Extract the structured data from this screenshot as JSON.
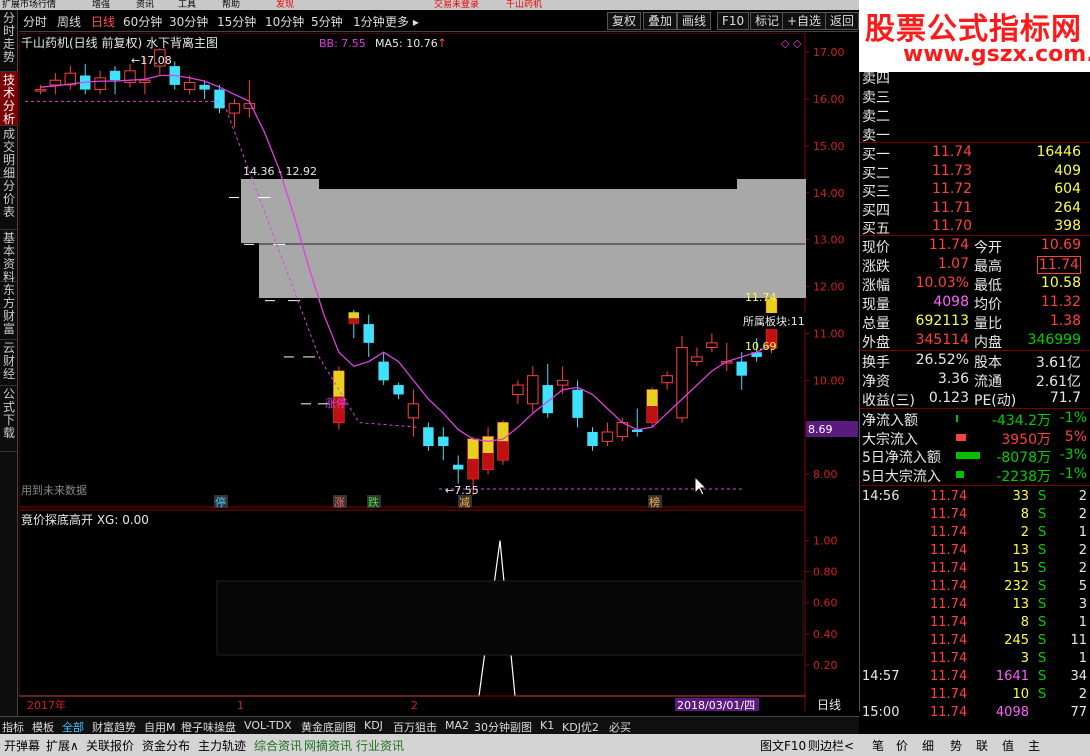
{
  "top_menu": [
    "扩展市场行情",
    "增强",
    "资讯",
    "工具",
    "帮助",
    "发现",
    "交易未登录",
    "千山药机"
  ],
  "sidebar": [
    "分时走势",
    "技术分析",
    "成交明细",
    "分价表",
    "基本资料",
    "东方财富",
    "云财经",
    "公式下载"
  ],
  "periods": [
    "分时",
    "周线",
    "日线",
    "60分钟",
    "30分钟",
    "15分钟",
    "10分钟",
    "5分钟",
    "1分钟",
    "更多 ▸"
  ],
  "tool_buttons": [
    "复权",
    "叠加",
    "画线",
    "F10",
    "标记",
    "+自选",
    "返回"
  ],
  "main": {
    "title": "千山药机(日线 前复权) 水下背离主图",
    "bb": "BB: 7.55",
    "ma5": "MA5: 10.76",
    "ma5_arrow": "↑",
    "y_ticks": [
      "17.00",
      "16.00",
      "15.00",
      "14.00",
      "13.00",
      "12.00",
      "11.00",
      "10.00",
      "9.00",
      "8.00"
    ],
    "high_label": "17.08",
    "low_label": "7.55",
    "range_label": "14.36 - 12.92",
    "last_label": "11.74",
    "prev_label": "10.69",
    "sector_label": "所属板块:11",
    "zt_label": "涨停",
    "future_label": "用到未来数据",
    "price_tag": "8.69",
    "markers": [
      "停",
      "涨",
      "跌",
      "减",
      "榜"
    ],
    "diamonds": "◇ ◇"
  },
  "indicator": {
    "title": "竟价探底高开 XG: 0.00",
    "y_ticks": [
      "1.00",
      "0.80",
      "0.60",
      "0.40",
      "0.20"
    ]
  },
  "x_axis": {
    "start": "2017年",
    "m1": "1",
    "m2": "2",
    "date": "2018/03/01/四",
    "mode": "日线"
  },
  "watermark": {
    "line1": "股票公式指标网",
    "line2": "www.gszx.com.cn"
  },
  "order_book": {
    "sell": [
      "卖四",
      "卖三",
      "卖二",
      "卖一"
    ],
    "buy": [
      {
        "l": "买一",
        "p": "11.74",
        "v": "16446"
      },
      {
        "l": "买二",
        "p": "11.73",
        "v": "409"
      },
      {
        "l": "买三",
        "p": "11.72",
        "v": "604"
      },
      {
        "l": "买四",
        "p": "11.71",
        "v": "264"
      },
      {
        "l": "买五",
        "p": "11.70",
        "v": "398"
      }
    ]
  },
  "quote": [
    {
      "l1": "现价",
      "v1": "11.74",
      "c1": "r",
      "l2": "今开",
      "v2": "10.69",
      "c2": "r"
    },
    {
      "l1": "涨跌",
      "v1": "1.07",
      "c1": "r",
      "l2": "最高",
      "v2": "11.74",
      "c2": "rb"
    },
    {
      "l1": "涨幅",
      "v1": "10.03%",
      "c1": "r",
      "l2": "最低",
      "v2": "10.58",
      "c2": "y"
    },
    {
      "l1": "现量",
      "v1": "4098",
      "c1": "m",
      "l2": "均价",
      "v2": "11.32",
      "c2": "r"
    },
    {
      "l1": "总量",
      "v1": "692113",
      "c1": "y",
      "l2": "量比",
      "v2": "1.38",
      "c2": "r"
    },
    {
      "l1": "外盘",
      "v1": "345114",
      "c1": "r",
      "l2": "内盘",
      "v2": "346999",
      "c2": "g"
    }
  ],
  "quote2": [
    {
      "l1": "换手",
      "v1": "26.52%",
      "l2": "股本",
      "v2": "3.61亿"
    },
    {
      "l1": "净资",
      "v1": "3.36",
      "l2": "流通",
      "v2": "2.61亿"
    },
    {
      "l1": "收益(三)",
      "v1": "0.123",
      "l2": "PE(动)",
      "v2": "71.7"
    }
  ],
  "flows": [
    {
      "l": "净流入额",
      "v": "-434.2万",
      "p": "-1%",
      "vc": "g",
      "bar": 0,
      "bc": "#00c000"
    },
    {
      "l": "大宗流入",
      "v": "3950万",
      "p": "5%",
      "vc": "r",
      "bar": 10,
      "bc": "#ff4040"
    },
    {
      "l": "5日净流入额",
      "v": "-8078万",
      "p": "-3%",
      "vc": "g",
      "bar": 24,
      "bc": "#00c000"
    },
    {
      "l": "5日大宗流入",
      "v": "-2238万",
      "p": "-1%",
      "vc": "g",
      "bar": 8,
      "bc": "#00c000"
    }
  ],
  "ticks": [
    {
      "t": "14:56",
      "p": "11.74",
      "v": "33",
      "s": "S",
      "n": "2"
    },
    {
      "t": "",
      "p": "11.74",
      "v": "8",
      "s": "S",
      "n": "2"
    },
    {
      "t": "",
      "p": "11.74",
      "v": "2",
      "s": "S",
      "n": "1"
    },
    {
      "t": "",
      "p": "11.74",
      "v": "13",
      "s": "S",
      "n": "2"
    },
    {
      "t": "",
      "p": "11.74",
      "v": "15",
      "s": "S",
      "n": "2"
    },
    {
      "t": "",
      "p": "11.74",
      "v": "232",
      "s": "S",
      "n": "5"
    },
    {
      "t": "",
      "p": "11.74",
      "v": "13",
      "s": "S",
      "n": "3"
    },
    {
      "t": "",
      "p": "11.74",
      "v": "8",
      "s": "S",
      "n": "1"
    },
    {
      "t": "",
      "p": "11.74",
      "v": "245",
      "s": "S",
      "n": "11"
    },
    {
      "t": "",
      "p": "11.74",
      "v": "3",
      "s": "S",
      "n": "1"
    },
    {
      "t": "14:57",
      "p": "11.74",
      "v": "1641",
      "s": "S",
      "n": "34"
    },
    {
      "t": "",
      "p": "11.74",
      "v": "10",
      "s": "S",
      "n": "2"
    },
    {
      "t": "15:00",
      "p": "11.74",
      "v": "4098",
      "s": "",
      "n": "77"
    }
  ],
  "bottom_tabs": [
    "指标",
    "模板",
    "全部",
    "财富趋势",
    "自用M",
    "橙子味操盘",
    "VOL-TDX",
    "黄金底副图",
    "KDJ",
    "百万狙击",
    "MA2",
    "30分钟副图",
    "K1",
    "KDJ优2",
    "必买"
  ],
  "status_bar": [
    "开弹幕",
    "扩展∧",
    "关联报价",
    "资金分布",
    "主力轨迹",
    "综合资讯",
    "网摘资讯",
    "行业资讯",
    "图文F10",
    "则边栏<",
    "笔",
    "价",
    "细",
    "势",
    "联",
    "值",
    "主"
  ],
  "chart_data": {
    "type": "candlestick",
    "title": "千山药机(日线 前复权) 水下背离主图",
    "ylim": [
      7.3,
      17.3
    ],
    "candles": [
      {
        "o": 16.2,
        "c": 16.2,
        "h": 16.3,
        "l": 16.1
      },
      {
        "o": 16.3,
        "c": 16.4,
        "h": 16.55,
        "l": 16.1
      },
      {
        "o": 16.3,
        "c": 16.55,
        "h": 16.7,
        "l": 16.2
      },
      {
        "o": 16.5,
        "c": 16.2,
        "h": 16.75,
        "l": 16.1
      },
      {
        "o": 16.2,
        "c": 16.45,
        "h": 16.6,
        "l": 16.1
      },
      {
        "o": 16.6,
        "c": 16.4,
        "h": 16.7,
        "l": 16.1
      },
      {
        "o": 16.35,
        "c": 16.6,
        "h": 16.75,
        "l": 16.25
      },
      {
        "o": 16.35,
        "c": 16.4,
        "h": 16.9,
        "l": 16.1
      },
      {
        "o": 16.7,
        "c": 17.05,
        "h": 17.08,
        "l": 16.5
      },
      {
        "o": 16.7,
        "c": 16.3,
        "h": 16.8,
        "l": 16.2
      },
      {
        "o": 16.2,
        "c": 16.35,
        "h": 16.5,
        "l": 16.1
      },
      {
        "o": 16.3,
        "c": 16.2,
        "h": 16.4,
        "l": 16.0
      },
      {
        "o": 16.2,
        "c": 15.8,
        "h": 16.3,
        "l": 15.7
      },
      {
        "o": 15.7,
        "c": 15.9,
        "h": 16.0,
        "l": 15.4
      },
      {
        "o": 15.8,
        "c": 15.9,
        "h": 16.4,
        "l": 15.6
      },
      {
        "o": 13.9,
        "c": 13.9,
        "h": 13.9,
        "l": 13.9
      },
      {
        "o": 12.9,
        "c": 12.9,
        "h": 12.9,
        "l": 12.9
      },
      {
        "o": 11.7,
        "c": 11.7,
        "h": 11.7,
        "l": 11.7
      },
      {
        "o": 10.5,
        "c": 10.5,
        "h": 10.5,
        "l": 10.5
      },
      {
        "o": 9.5,
        "c": 9.5,
        "h": 9.5,
        "l": 9.5
      },
      {
        "o": 9.1,
        "c": 10.2,
        "h": 10.3,
        "l": 8.95
      },
      {
        "o": 11.45,
        "c": 11.2,
        "h": 11.5,
        "l": 10.9
      },
      {
        "o": 11.2,
        "c": 10.8,
        "h": 11.4,
        "l": 10.5
      },
      {
        "o": 10.4,
        "c": 10.0,
        "h": 10.6,
        "l": 9.9
      },
      {
        "o": 9.9,
        "c": 9.7,
        "h": 9.95,
        "l": 9.6
      },
      {
        "o": 9.2,
        "c": 9.5,
        "h": 9.8,
        "l": 8.8
      },
      {
        "o": 9.0,
        "c": 8.6,
        "h": 9.1,
        "l": 8.5
      },
      {
        "o": 8.8,
        "c": 8.6,
        "h": 9.0,
        "l": 8.3
      },
      {
        "o": 8.2,
        "c": 8.1,
        "h": 8.4,
        "l": 7.8
      },
      {
        "o": 7.9,
        "c": 8.75,
        "h": 8.8,
        "l": 7.55
      },
      {
        "o": 8.1,
        "c": 8.8,
        "h": 9.0,
        "l": 8.0
      },
      {
        "o": 8.3,
        "c": 9.1,
        "h": 9.15,
        "l": 8.2
      },
      {
        "o": 9.7,
        "c": 9.9,
        "h": 10.0,
        "l": 9.5
      },
      {
        "o": 9.5,
        "c": 10.1,
        "h": 10.3,
        "l": 9.3
      },
      {
        "o": 9.9,
        "c": 9.3,
        "h": 10.35,
        "l": 9.2
      },
      {
        "o": 9.9,
        "c": 10.0,
        "h": 10.3,
        "l": 9.7
      },
      {
        "o": 9.8,
        "c": 9.2,
        "h": 10.0,
        "l": 9.0
      },
      {
        "o": 8.9,
        "c": 8.6,
        "h": 9.0,
        "l": 8.5
      },
      {
        "o": 8.7,
        "c": 8.9,
        "h": 9.1,
        "l": 8.6
      },
      {
        "o": 8.8,
        "c": 9.1,
        "h": 9.2,
        "l": 8.7
      },
      {
        "o": 8.95,
        "c": 8.9,
        "h": 9.4,
        "l": 8.8
      },
      {
        "o": 9.1,
        "c": 9.8,
        "h": 9.85,
        "l": 9.0
      },
      {
        "o": 9.95,
        "c": 10.1,
        "h": 10.2,
        "l": 9.8
      },
      {
        "o": 9.2,
        "c": 10.7,
        "h": 10.95,
        "l": 9.1
      },
      {
        "o": 10.4,
        "c": 10.5,
        "h": 10.7,
        "l": 10.3
      },
      {
        "o": 10.7,
        "c": 10.8,
        "h": 11.0,
        "l": 10.6
      },
      {
        "o": 10.4,
        "c": 10.4,
        "h": 10.8,
        "l": 10.2
      },
      {
        "o": 10.4,
        "c": 10.1,
        "h": 10.6,
        "l": 9.8
      },
      {
        "o": 10.6,
        "c": 10.5,
        "h": 10.9,
        "l": 10.4
      },
      {
        "o": 10.69,
        "c": 11.74,
        "h": 11.74,
        "l": 10.58
      }
    ],
    "ma5": [
      16.25,
      16.28,
      16.32,
      16.36,
      16.38,
      16.38,
      16.4,
      16.42,
      16.5,
      16.5,
      16.45,
      16.38,
      16.25,
      16.1,
      15.95,
      15.3,
      14.5,
      13.5,
      12.4,
      11.4,
      10.6,
      10.3,
      10.4,
      10.6,
      10.4,
      10.0,
      9.6,
      9.3,
      8.95,
      8.75,
      8.7,
      8.75,
      9.0,
      9.3,
      9.55,
      9.8,
      9.85,
      9.7,
      9.4,
      9.1,
      8.95,
      9.0,
      9.3,
      9.6,
      9.9,
      10.2,
      10.4,
      10.5,
      10.6,
      10.76
    ],
    "indicator": {
      "ylim": [
        0,
        1.1
      ],
      "spike": 1.0
    }
  }
}
